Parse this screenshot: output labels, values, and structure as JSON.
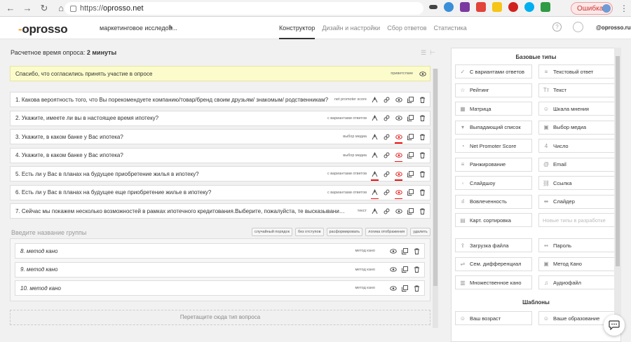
{
  "browser": {
    "url_scheme": "https://",
    "url_host": "oprosso.net",
    "error_label": "Ошибка"
  },
  "header": {
    "logo_dash": "-",
    "logo_text": "oprosso",
    "survey_name": "маркетинговое исследов...",
    "tabs": [
      "Конструктор",
      "Дизайн и настройки",
      "Сбор ответов",
      "Статистика"
    ],
    "help": "?",
    "user": "@oprosso.ru"
  },
  "left": {
    "estimated_time_label": "Расчетное время опроса:",
    "estimated_time_value": "2 минуты",
    "greeting": {
      "text": "Спасибо, что согласились принять участие в опросе",
      "type": "приветствие"
    },
    "questions": [
      {
        "text": "1. Какова вероятность того, что Вы порекомендуете компанию/товар/бренд своим друзьям/ знакомым/ родственникам?",
        "type": "net promoter score",
        "eye_red": false
      },
      {
        "text": "2. Укажите, имеете ли вы в настоящее время ипотеку?",
        "type": "с вариантами ответов",
        "eye_red": false
      },
      {
        "text": "3. Укажите, в каком банке у Вас ипотека?",
        "type": "выбор медиа",
        "eye_red": true
      },
      {
        "text": "4. Укажите, в каком банке у Вас ипотека?",
        "type": "выбор медиа",
        "eye_red": true
      },
      {
        "text": "5. Есть ли у Вас в планах на будущее приобретение жилья в ипотеку?",
        "type": "с вариантами ответов",
        "eye_red": true
      },
      {
        "text": "6. Есть ли у Вас в планах на будущее еще приобретение жилье в ипотеку?",
        "type": "с вариантами ответов",
        "eye_red": true
      },
      {
        "text": "7. Сейчас мы покажем несколько возможностей в рамках ипотечного кредитования.Выберите, пожалуйста, те высказывания, которые ...",
        "type": "текст",
        "eye_red": false
      }
    ],
    "group_placeholder": "Введите название группы",
    "group_buttons": [
      "случайный порядок",
      "без отступов",
      "расформировать",
      "логика отображения",
      "удалить"
    ],
    "group_questions": [
      {
        "text": "8. метод кано",
        "type": "метод кано"
      },
      {
        "text": "9. метод кано",
        "type": "метод кано"
      },
      {
        "text": "10. метод кано",
        "type": "метод кано"
      }
    ],
    "drop_zone": "Перетащите сюда тип вопроса"
  },
  "right": {
    "basic_title": "Базовые типы",
    "basic_types": [
      [
        "С вариантами ответов",
        "Текстовый ответ"
      ],
      [
        "Рейтинг",
        "Текст"
      ],
      [
        "Матрица",
        "Шкала мнения"
      ],
      [
        "Выпадающий список",
        "Выбор медиа"
      ],
      [
        "Net Promoter Score",
        "Число"
      ],
      [
        "Ранжирование",
        "Email"
      ],
      [
        "Слайдшоу",
        "Ссылка"
      ],
      [
        "Вовлеченность",
        "Слайдер"
      ],
      [
        "Карт. сортировка",
        "Новые типы в разработке"
      ]
    ],
    "extra_types": [
      [
        "Загрузка файла",
        "Пароль"
      ],
      [
        "Сем. дифференциал",
        "Метод Кано"
      ],
      [
        "Множественное кано",
        "Аудиофайл"
      ]
    ],
    "templates_title": "Шаблоны",
    "templates": [
      [
        "Ваш возраст",
        "Ваше образование"
      ]
    ]
  },
  "colors": {
    "accent": "#f59b1b",
    "eye_red": "#e11111",
    "greeting_bg": "#fbfbcb"
  }
}
